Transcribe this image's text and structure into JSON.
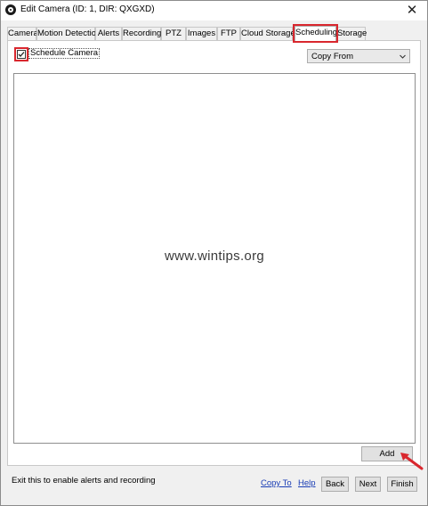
{
  "window": {
    "title": "Edit Camera (ID: 1, DIR: QXGXD)",
    "close_glyph": "✕"
  },
  "tabs": [
    {
      "label": "Camera",
      "active": false
    },
    {
      "label": "Motion Detection",
      "active": false
    },
    {
      "label": "Alerts",
      "active": false
    },
    {
      "label": "Recording",
      "active": false
    },
    {
      "label": "PTZ",
      "active": false
    },
    {
      "label": "Images",
      "active": false
    },
    {
      "label": "FTP",
      "active": false
    },
    {
      "label": "Cloud Storage",
      "active": false
    },
    {
      "label": "Scheduling",
      "active": true
    },
    {
      "label": "Storage",
      "active": false
    }
  ],
  "scheduling": {
    "schedule_camera_label": "Schedule Camera",
    "schedule_camera_checked": true,
    "copy_from": {
      "selected": "Copy From"
    },
    "watermark": "www.wintips.org",
    "add_label": "Add"
  },
  "footer": {
    "status_text": "Exit this to enable alerts and recording",
    "copy_to_label": "Copy To",
    "help_label": "Help",
    "back_label": "Back",
    "next_label": "Next",
    "finish_label": "Finish"
  },
  "colors": {
    "highlight_red": "#d9272e",
    "link_blue": "#1a3db5",
    "dialog_bg": "#f0f0f0"
  },
  "icons": {
    "app": "camera-app-icon",
    "close": "close-icon",
    "check": "checkmark-icon",
    "dropdown": "chevron-down-icon",
    "annotation": "red-arrow-icon"
  }
}
